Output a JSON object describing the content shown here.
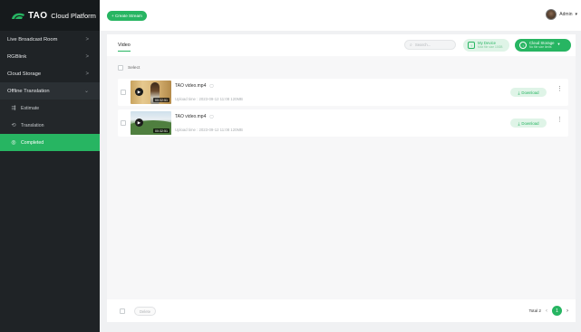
{
  "brand": {
    "logo_text": "TAO",
    "title": "Cloud Platform"
  },
  "sidebar": {
    "items": [
      {
        "label": "Live Broadcast Room",
        "chevron": ">"
      },
      {
        "label": "RGBlink",
        "chevron": ">"
      },
      {
        "label": "Cloud Storage",
        "chevron": ">"
      },
      {
        "label": "Offline Translation",
        "chevron": "⌄"
      }
    ],
    "sub_items": [
      {
        "label": "Estimate",
        "icon": "estimate-icon"
      },
      {
        "label": "Translation",
        "icon": "translation-icon"
      },
      {
        "label": "Completed",
        "icon": "completed-icon"
      }
    ]
  },
  "topbar": {
    "create_label": "+ Create Stream",
    "user_name": "Admin"
  },
  "tabs": {
    "video": "Video"
  },
  "search": {
    "placeholder": "Search..."
  },
  "my_device": {
    "title": "My Device",
    "subtitle": "Max file size 10GB"
  },
  "cloud_storage": {
    "title": "Cloud Storage",
    "subtitle": "No file size limits"
  },
  "list": {
    "select_label": "Select",
    "rows": [
      {
        "name": "TAO video.mp4",
        "meta": "Upload time : 2023-09-12 11:08   120MB",
        "duration": "00:32:51",
        "download": "Download"
      },
      {
        "name": "TAO video.mp4",
        "meta": "Upload time : 2023-09-12 11:08   120MB",
        "duration": "00:32:51",
        "download": "Download"
      }
    ]
  },
  "footer": {
    "delete_label": "Delete",
    "total": "Total 2",
    "page": "1"
  },
  "colors": {
    "accent": "#27b562",
    "sidebar_bg": "#1f2326",
    "panel_bg": "#f7f7f8"
  }
}
